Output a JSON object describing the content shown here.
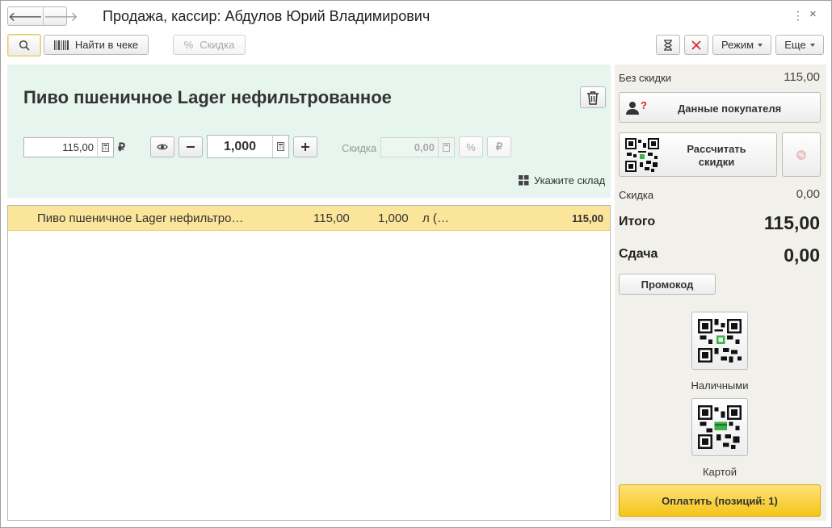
{
  "window": {
    "title": "Продажа, кассир: Абдулов Юрий Владимирович"
  },
  "toolbar": {
    "find_in_receipt_label": "Найти в чеке",
    "discount_label": "Скидка",
    "mode_label": "Режим",
    "more_label": "Еще"
  },
  "product": {
    "name": "Пиво пшеничное Lager нефильтрованное",
    "price": "115,00",
    "currency_symbol": "₽",
    "quantity": "1,000",
    "discount_label": "Скидка",
    "discount_value": "0,00",
    "percent_symbol": "%",
    "warehouse_label": "Укажите склад"
  },
  "receipt": {
    "rows": [
      {
        "name": "Пиво пшеничное Lager нефильтро…",
        "price": "115,00",
        "quantity": "1,000",
        "unit": "л (…",
        "sum": "115,00"
      }
    ]
  },
  "summary": {
    "no_discount_label": "Без скидки",
    "no_discount_value": "115,00",
    "customer_data_label": "Данные покупателя",
    "calculate_discounts_label_line1": "Рассчитать",
    "calculate_discounts_label_line2": "скидки",
    "discount_label": "Скидка",
    "discount_value": "0,00",
    "total_label": "Итого",
    "total_value": "115,00",
    "change_label": "Сдача",
    "change_value": "0,00",
    "promo_label": "Промокод",
    "cash_label": "Наличными",
    "card_label": "Картой",
    "pay_label": "Оплатить (позиций: 1)"
  },
  "colors": {
    "product_panel_bg": "#e6f5ee",
    "selected_row_bg": "#fbe59a",
    "pay_button": "#f5c518",
    "right_panel_bg": "#f1f0ea",
    "cancel_icon": "#d9232b"
  }
}
